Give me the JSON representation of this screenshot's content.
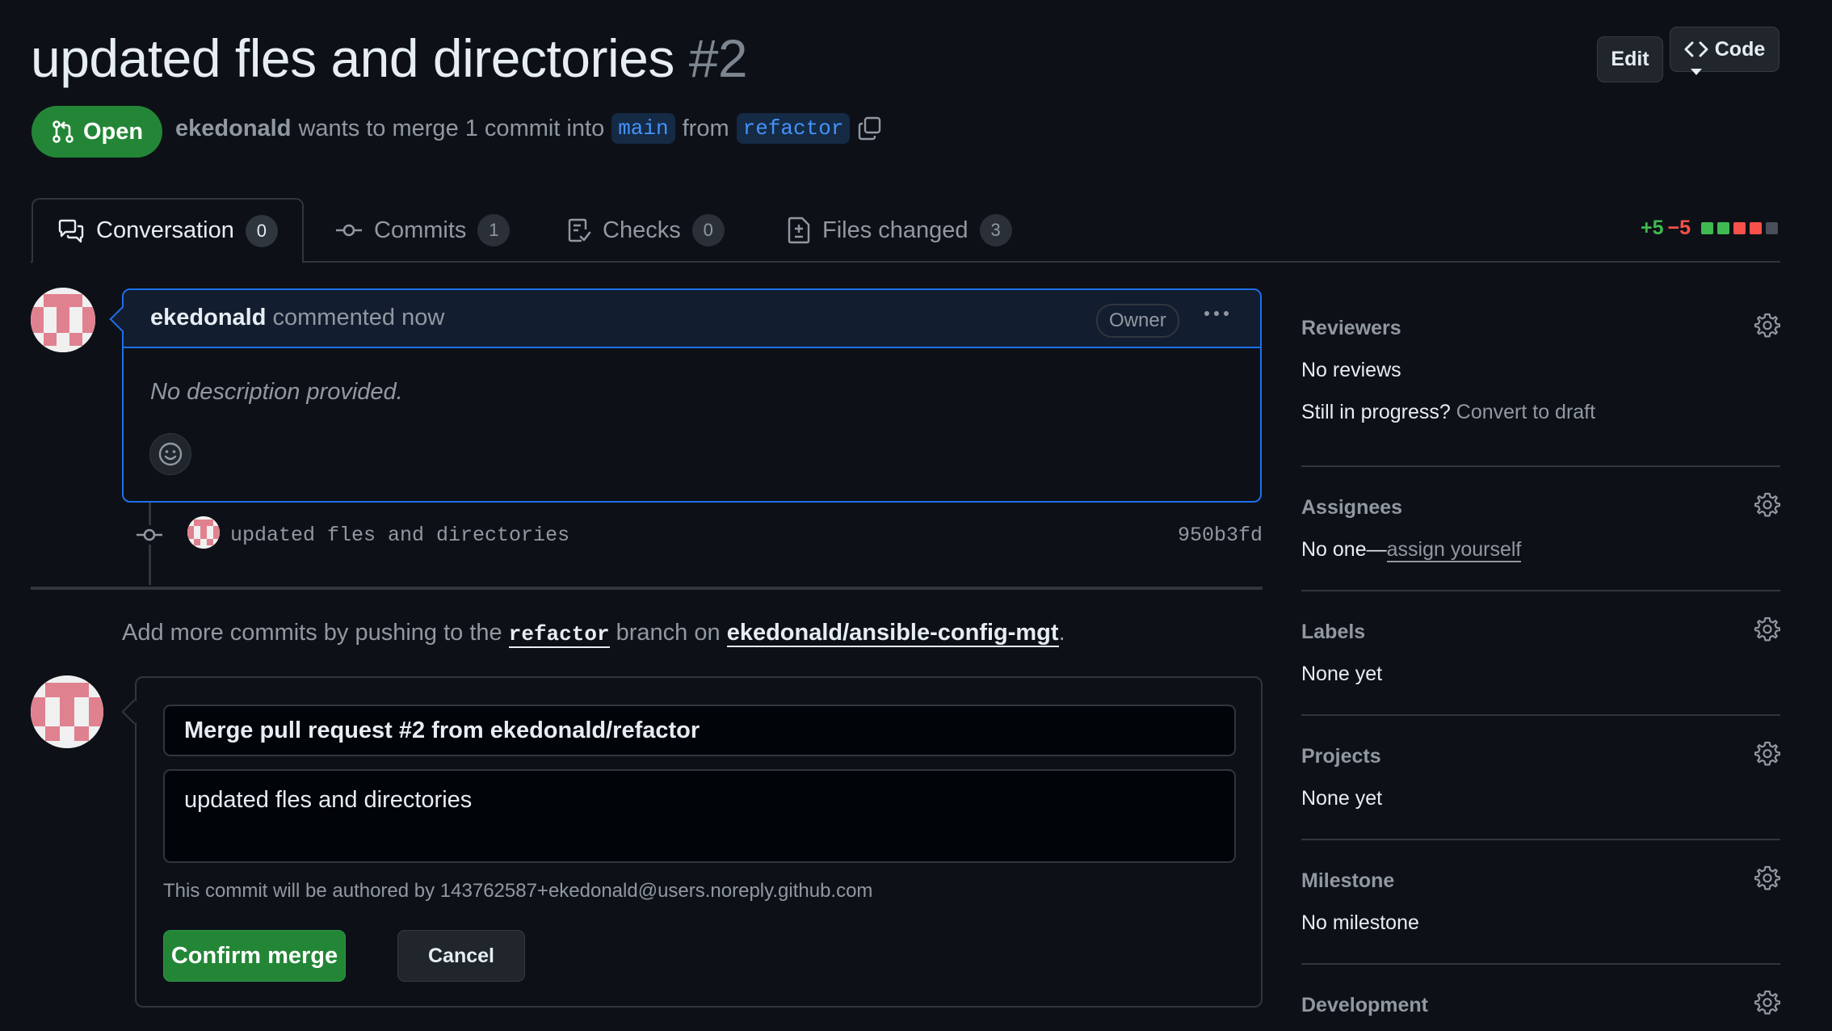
{
  "header": {
    "title": "updated fles and directories",
    "number": "#2",
    "edit_label": "Edit",
    "code_label": "Code"
  },
  "pr": {
    "state": "Open",
    "author": "ekedonald",
    "merge_text_1": "wants to merge 1 commit into",
    "base_branch": "main",
    "merge_text_2": "from",
    "head_branch": "refactor"
  },
  "tabs": [
    {
      "label": "Conversation",
      "count": "0",
      "icon": "comment-discussion-icon"
    },
    {
      "label": "Commits",
      "count": "1",
      "icon": "git-commit-icon"
    },
    {
      "label": "Checks",
      "count": "0",
      "icon": "checklist-icon"
    },
    {
      "label": "Files changed",
      "count": "3",
      "icon": "file-diff-icon"
    }
  ],
  "diffstat": {
    "additions": "+5",
    "deletions": "−5",
    "blocks": [
      "#3fb950",
      "#3fb950",
      "#f85149",
      "#f85149",
      "#484f58"
    ]
  },
  "comment": {
    "author": "ekedonald",
    "action": "commented now",
    "badge": "Owner",
    "body": "No description provided."
  },
  "commit": {
    "message": "updated fles and directories",
    "sha": "950b3fd"
  },
  "push_hint": {
    "text_1": "Add more commits by pushing to the",
    "branch": "refactor",
    "text_2": "branch on",
    "repo": "ekedonald/ansible-config-mgt",
    "text_3": "."
  },
  "merge_form": {
    "title_value": "Merge pull request #2 from ekedonald/refactor",
    "body_value": "updated fles and directories",
    "author_note": "This commit will be authored by 143762587+ekedonald@users.noreply.github.com",
    "confirm_label": "Confirm merge",
    "cancel_label": "Cancel"
  },
  "sidebar": {
    "reviewers": {
      "title": "Reviewers",
      "value": "No reviews",
      "progress_q": "Still in progress?",
      "progress_link": "Convert to draft"
    },
    "assignees": {
      "title": "Assignees",
      "value": "No one—",
      "link": "assign yourself"
    },
    "labels": {
      "title": "Labels",
      "value": "None yet"
    },
    "projects": {
      "title": "Projects",
      "value": "None yet"
    },
    "milestone": {
      "title": "Milestone",
      "value": "No milestone"
    },
    "development": {
      "title": "Development"
    }
  },
  "colors": {
    "background": "#0d1117",
    "accent_green": "#238636",
    "accent_blue": "#1f6feb",
    "text_muted": "#9198a1"
  }
}
